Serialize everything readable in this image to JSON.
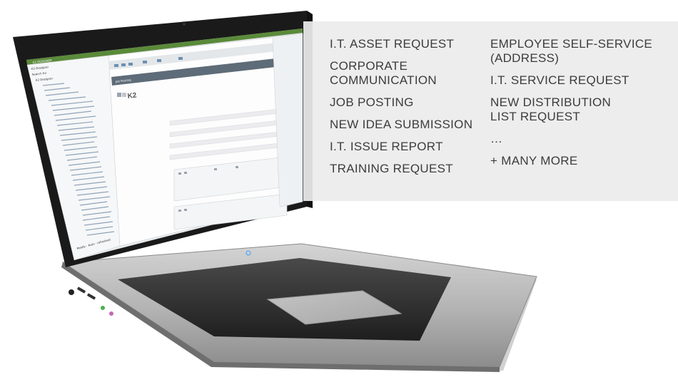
{
  "overlay": {
    "column1": [
      "I.T. ASSET REQUEST",
      "CORPORATE\nCOMMUNICATION",
      "JOB POSTING",
      "NEW IDEA SUBMISSION",
      "I.T. ISSUE REPORT",
      "TRAINING REQUEST"
    ],
    "column2": [
      "EMPLOYEE SELF-SERVICE\n(ADDRESS)",
      "I.T. SERVICE REQUEST",
      "NEW DISTRIBUTION\nLIST REQUEST",
      "…",
      "+ MANY MORE"
    ]
  },
  "screen": {
    "app_title": "K2 DESIGNER",
    "designer_panel_title": "K2 Designer",
    "search_placeholder": "Search for",
    "tree_root": "K2 Designer",
    "logo_text": "K2",
    "form_header": "Job Posting",
    "status_text": "Ready - Auto - refreshed"
  },
  "colors": {
    "overlay_bg": "#ececec",
    "overlay_text": "#3c3c3c",
    "app_titlebar": "#5a8a3a",
    "laptop_body": "#b8b8b8",
    "keyboard": "#2a2a2a"
  }
}
